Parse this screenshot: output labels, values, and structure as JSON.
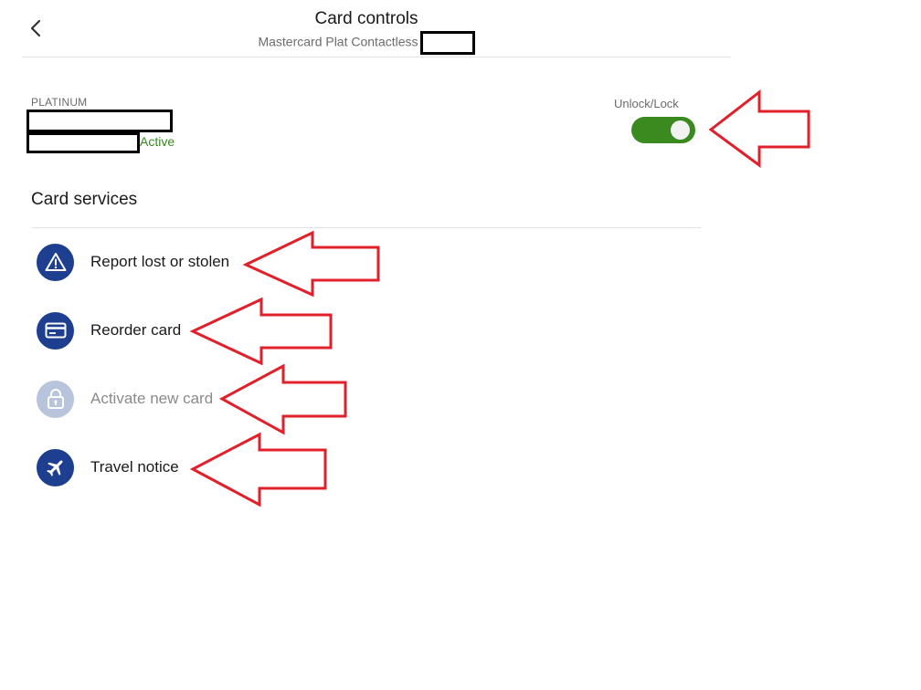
{
  "header": {
    "title": "Card controls",
    "subtitle": "Mastercard Plat Contactless"
  },
  "card": {
    "tier": "PLATINUM",
    "status": "Active"
  },
  "lock_toggle": {
    "label": "Unlock/Lock",
    "state": "on",
    "color": "#3a8a1f"
  },
  "card_services": {
    "title": "Card services",
    "items": [
      {
        "label": "Report lost or stolen",
        "icon": "warning-triangle-icon",
        "enabled": true
      },
      {
        "label": "Reorder card",
        "icon": "credit-card-icon",
        "enabled": true
      },
      {
        "label": "Activate new card",
        "icon": "lock-icon",
        "enabled": false
      },
      {
        "label": "Travel notice",
        "icon": "airplane-icon",
        "enabled": true
      }
    ]
  },
  "colors": {
    "icon_circle": "#1e3f8f",
    "icon_circle_disabled": "#b8c3dc",
    "annotation_arrow": "#e0202a"
  }
}
